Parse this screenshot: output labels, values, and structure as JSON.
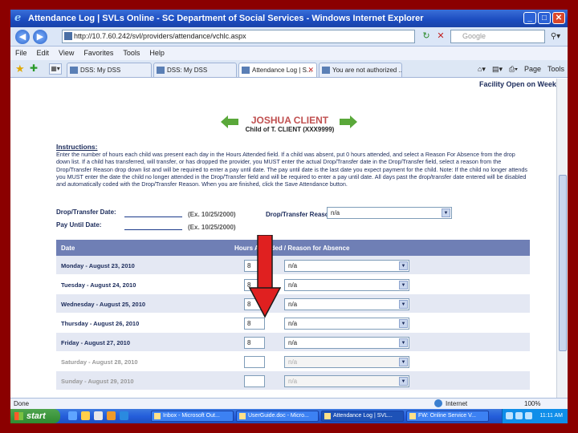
{
  "window": {
    "title": "Attendance Log | SVLs Online - SC Department of Social Services - Windows Internet Explorer",
    "controls": [
      "_",
      "□",
      "✕"
    ]
  },
  "address_bar": {
    "url": "http://10.7.60.242/svl/providers/attendance/vchlc.aspx",
    "search_placeholder": "Google"
  },
  "menu": [
    "File",
    "Edit",
    "View",
    "Favorites",
    "Tools",
    "Help"
  ],
  "tabs": [
    {
      "label": "DSS: My DSS"
    },
    {
      "label": "DSS: My DSS"
    },
    {
      "label": "Attendance Log | S..."
    },
    {
      "label": "You are not authorized ..."
    }
  ],
  "toolbar": {
    "page_label": "Page",
    "tools_label": "Tools"
  },
  "page": {
    "facility_notice": "Facility Open on Weekends: NO",
    "client_name": "JOSHUA CLIENT",
    "client_sub": "Child of T. CLIENT (XXX9999)",
    "instructions_title": "Instructions:",
    "instructions_text": "Enter the number of hours each child was present each day in the Hours Attended field. If a child was absent, put 0 hours attended, and select a Reason For Absence from the drop down list. If a child has transferred, will transfer, or has dropped the provider, you MUST enter the actual Drop/Transfer date in the Drop/Transfer field, select a reason from the Drop/Transfer Reason drop down list and will be required to enter a pay until date. The pay until date is the last date you expect payment for the child. Note: If the child no longer attends you MUST enter the date the child no longer attended in the Drop/Transfer field and will be required to enter a pay until date. All days past the drop/transfer date entered will be disabled and automatically coded with the Drop/Transfer Reason. When you are finished, click the Save Attendance button.",
    "drop_transfer_date_label": "Drop/Transfer Date:",
    "pay_until_date_label": "Pay Until Date:",
    "date_hint_1": "(Ex. 10/25/2000)",
    "date_hint_2": "(Ex. 10/25/2000)",
    "drop_transfer_reason_label": "Drop/Transfer Reason:",
    "drop_transfer_reason_value": "n/a",
    "table_headers": {
      "date": "Date",
      "hours": "Hours Attended / Reason for Absence"
    },
    "rows": [
      {
        "day": "Monday - August 23, 2010",
        "hours": "8",
        "reason": "n/a",
        "disabled": false
      },
      {
        "day": "Tuesday - August 24, 2010",
        "hours": "8",
        "reason": "n/a",
        "disabled": false
      },
      {
        "day": "Wednesday - August 25, 2010",
        "hours": "8",
        "reason": "n/a",
        "disabled": false
      },
      {
        "day": "Thursday - August 26, 2010",
        "hours": "8",
        "reason": "n/a",
        "disabled": false
      },
      {
        "day": "Friday - August 27, 2010",
        "hours": "8",
        "reason": "n/a",
        "disabled": false
      },
      {
        "day": "Saturday - August 28, 2010",
        "hours": "",
        "reason": "n/a",
        "disabled": true
      },
      {
        "day": "Sunday - August 29, 2010",
        "hours": "",
        "reason": "n/a",
        "disabled": true
      }
    ]
  },
  "status_bar": {
    "status": "Done",
    "zone": "Internet",
    "zoom": "100%"
  },
  "taskbar": {
    "start_label": "start",
    "tasks": [
      {
        "label": "Inbox - Microsoft Out..."
      },
      {
        "label": "UserGuide.doc - Micro..."
      },
      {
        "label": "Attendance Log | SVL..."
      },
      {
        "label": "FW: Online Service V..."
      }
    ],
    "clock": "11:11 AM"
  },
  "colors": {
    "slide_background": "#8b0000",
    "table_header": "#6f7fb5",
    "row_shade": "#e4e8f3",
    "annotation_arrow": "#e02020",
    "client_name": "#c05050"
  }
}
